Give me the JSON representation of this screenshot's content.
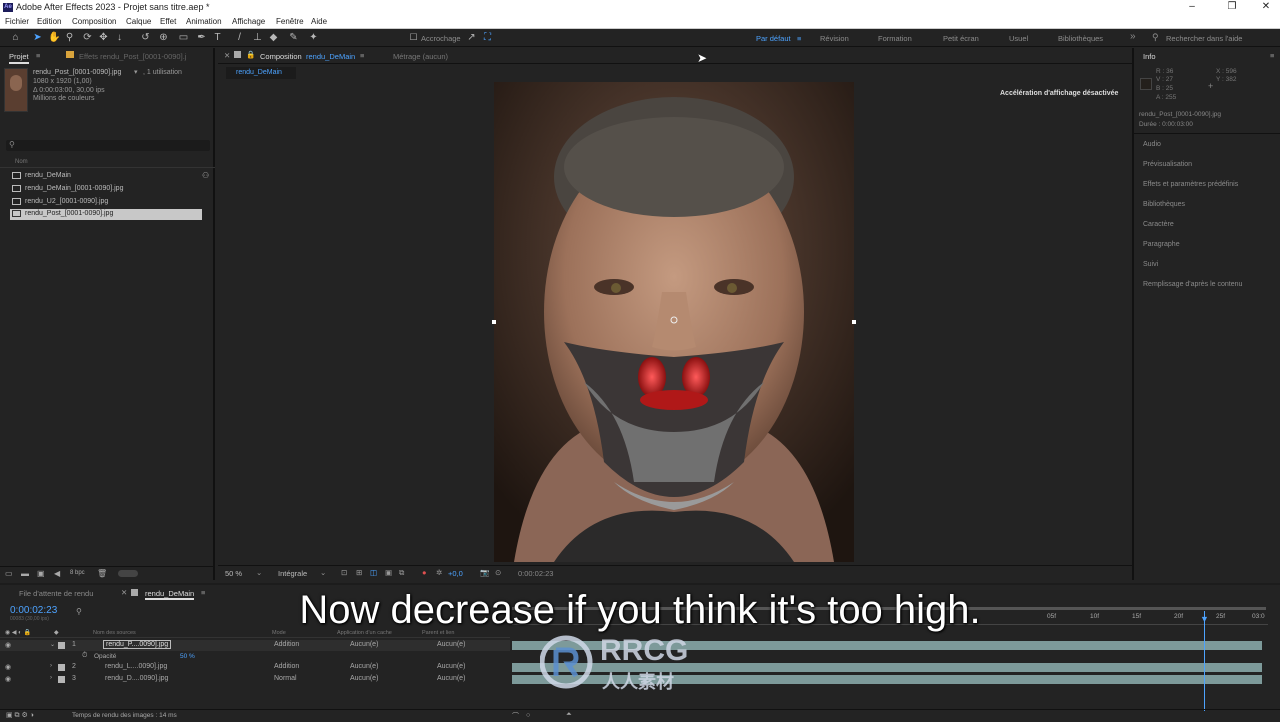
{
  "window": {
    "title": "Adobe After Effects 2023 - Projet sans titre.aep *",
    "app_badge": "Ae"
  },
  "menu": [
    "Fichier",
    "Edition",
    "Composition",
    "Calque",
    "Effet",
    "Animation",
    "Affichage",
    "Fenêtre",
    "Aide"
  ],
  "toolbar": {
    "snap_label": "Accrochage",
    "workspaces": [
      "Par défaut",
      "Révision",
      "Formation",
      "Petit écran",
      "Usuel",
      "Bibliothèques"
    ],
    "search_placeholder": "Rechercher dans l'aide"
  },
  "project": {
    "tab": "Projet",
    "effects_tab": "Effets rendu_Post_[0001-0090].j",
    "item_name": "rendu_Post_[0001-0090].jpg",
    "usage": ", 1 utilisation",
    "dims": "1080 x 1920 (1,00)",
    "duration": "Δ 0:00:03:00, 30,00 ips",
    "colors": "Millions de couleurs",
    "col_name": "Nom",
    "items": [
      "rendu_DeMain",
      "rendu_DeMain_[0001-0090].jpg",
      "rendu_U2_[0001-0090].jpg",
      "rendu_Post_[0001-0090].jpg"
    ],
    "bpc": "8 bpc"
  },
  "comp": {
    "tab_label": "Composition",
    "tab_name": "rendu_DeMain",
    "footage_tab": "Métrage (aucun)",
    "breadcrumb": "rendu_DeMain",
    "accel_msg": "Accélération d'affichage désactivée",
    "zoom": "50 %",
    "quality": "Intégrale",
    "exposure": "+0,0",
    "time": "0:00:02:23"
  },
  "info": {
    "title": "Info",
    "r": "R : 36",
    "v": "V : 27",
    "b": "B : 25",
    "a": "A : 255",
    "x": "X : 596",
    "y": "Y : 382",
    "file": "rendu_Post_[0001-0090].jpg",
    "duree": "Durée : 0:00:03:00",
    "panels": [
      "Audio",
      "Prévisualisation",
      "Effets et paramètres prédéfinis",
      "Bibliothèques",
      "Caractère",
      "Paragraphe",
      "Suivi",
      "Remplissage d'après le contenu"
    ]
  },
  "timeline": {
    "queue_tab": "File d'attente de rendu",
    "comp_tab": "rendu_DeMain",
    "timecode": "0:00:02:23",
    "frame_info": "00083 (30,00 ips)",
    "col_source": "Nom des sources",
    "col_mode": "Mode",
    "col_matte": "Application d'un cache",
    "col_parent": "Parent et lien",
    "ruler": [
      "05f",
      "10f",
      "15f",
      "20f",
      "25f",
      "03:0"
    ],
    "layers": [
      {
        "num": "1",
        "name": "rendu_P....0090].jpg",
        "mode": "Addition",
        "matte": "Aucun(e)",
        "parent": "Aucun(e)"
      },
      {
        "num": "2",
        "name": "rendu_L....0090].jpg",
        "mode": "Addition",
        "matte": "Aucun(e)",
        "parent": "Aucun(e)"
      },
      {
        "num": "3",
        "name": "rendu_D....0090].jpg",
        "mode": "Normal",
        "matte": "Aucun(e)",
        "parent": "Aucun(e)"
      }
    ],
    "opacity_label": "Opacité",
    "opacity_value": "50 %",
    "render_time": "Temps de rendu des images : 14 ms"
  },
  "overlay": {
    "subtitle": "Now decrease if you think it's too high.",
    "wm_main": "RRCG",
    "wm_sub": "人人素材"
  }
}
